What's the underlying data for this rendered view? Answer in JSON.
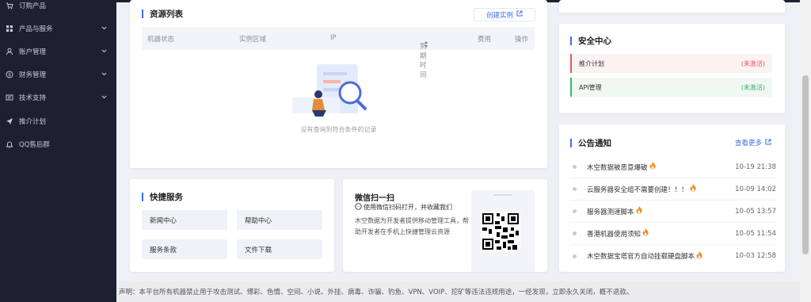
{
  "sidebar": {
    "items": [
      {
        "label": "订购产品",
        "icon": "cart-icon",
        "chevron": false
      },
      {
        "label": "产品与服务",
        "icon": "grid-icon",
        "chevron": true
      },
      {
        "label": "账户管理",
        "icon": "user-icon",
        "chevron": true
      },
      {
        "label": "财务管理",
        "icon": "money-icon",
        "chevron": true
      },
      {
        "label": "技术支持",
        "icon": "ticket-icon",
        "chevron": true
      },
      {
        "label": "推介计划",
        "icon": "send-icon",
        "chevron": false
      },
      {
        "label": "QQ售后群",
        "icon": "bell-icon",
        "chevron": false
      }
    ]
  },
  "resources": {
    "title": "资源列表",
    "create_label": "创建实例",
    "columns": [
      "机器状态",
      "实例区域",
      "IP",
      "到期时间",
      "费用",
      "操作"
    ],
    "empty_text": "没有查询到符合条件的记录"
  },
  "quick": {
    "title": "快捷服务",
    "buttons": [
      "新闻中心",
      "帮助中心",
      "服务条款",
      "文件下载"
    ]
  },
  "wechat": {
    "title": "微信扫一扫",
    "subtitle": "使用微信扫码打开，并收藏我们",
    "desc": "木空数据为开发者提供移动管理工具，帮助开发者在手机上快捷管理云资源"
  },
  "security": {
    "title": "安全中心",
    "rows": [
      {
        "label": "推介计划",
        "status": "(未激活)",
        "color": "#e05a5a",
        "bg": "#fdf2f2"
      },
      {
        "label": "API管理",
        "status": "(未激活)",
        "color": "#3cb371",
        "bg": "#f1f8f3"
      }
    ]
  },
  "notice": {
    "title": "公告通知",
    "more_label": "查看更多",
    "items": [
      {
        "text": "木空数据被恶意爆破",
        "date": "10-19 21:38"
      },
      {
        "text": "云服务器安全组不需要创建！！！",
        "date": "10-09 14:02"
      },
      {
        "text": "服务器测速脚本",
        "date": "10-05 13:57"
      },
      {
        "text": "香港机器使用须知",
        "date": "10-05 11:54"
      },
      {
        "text": "木空数据宝塔官方自动挂载硬盘脚本",
        "date": "10-03 12:58"
      }
    ]
  },
  "footer": {
    "text": "声明：本平台所有机器禁止用于攻击测试、博彩、色情、空间、小说、外挂、病毒、诈骗、钓鱼、VPN、VOIP、挖矿等违法违规用途，一经发现，立即永久关闭，概不退款。"
  },
  "colors": {
    "accent": "#3b6fe0",
    "sidebar": "#1e2030"
  }
}
